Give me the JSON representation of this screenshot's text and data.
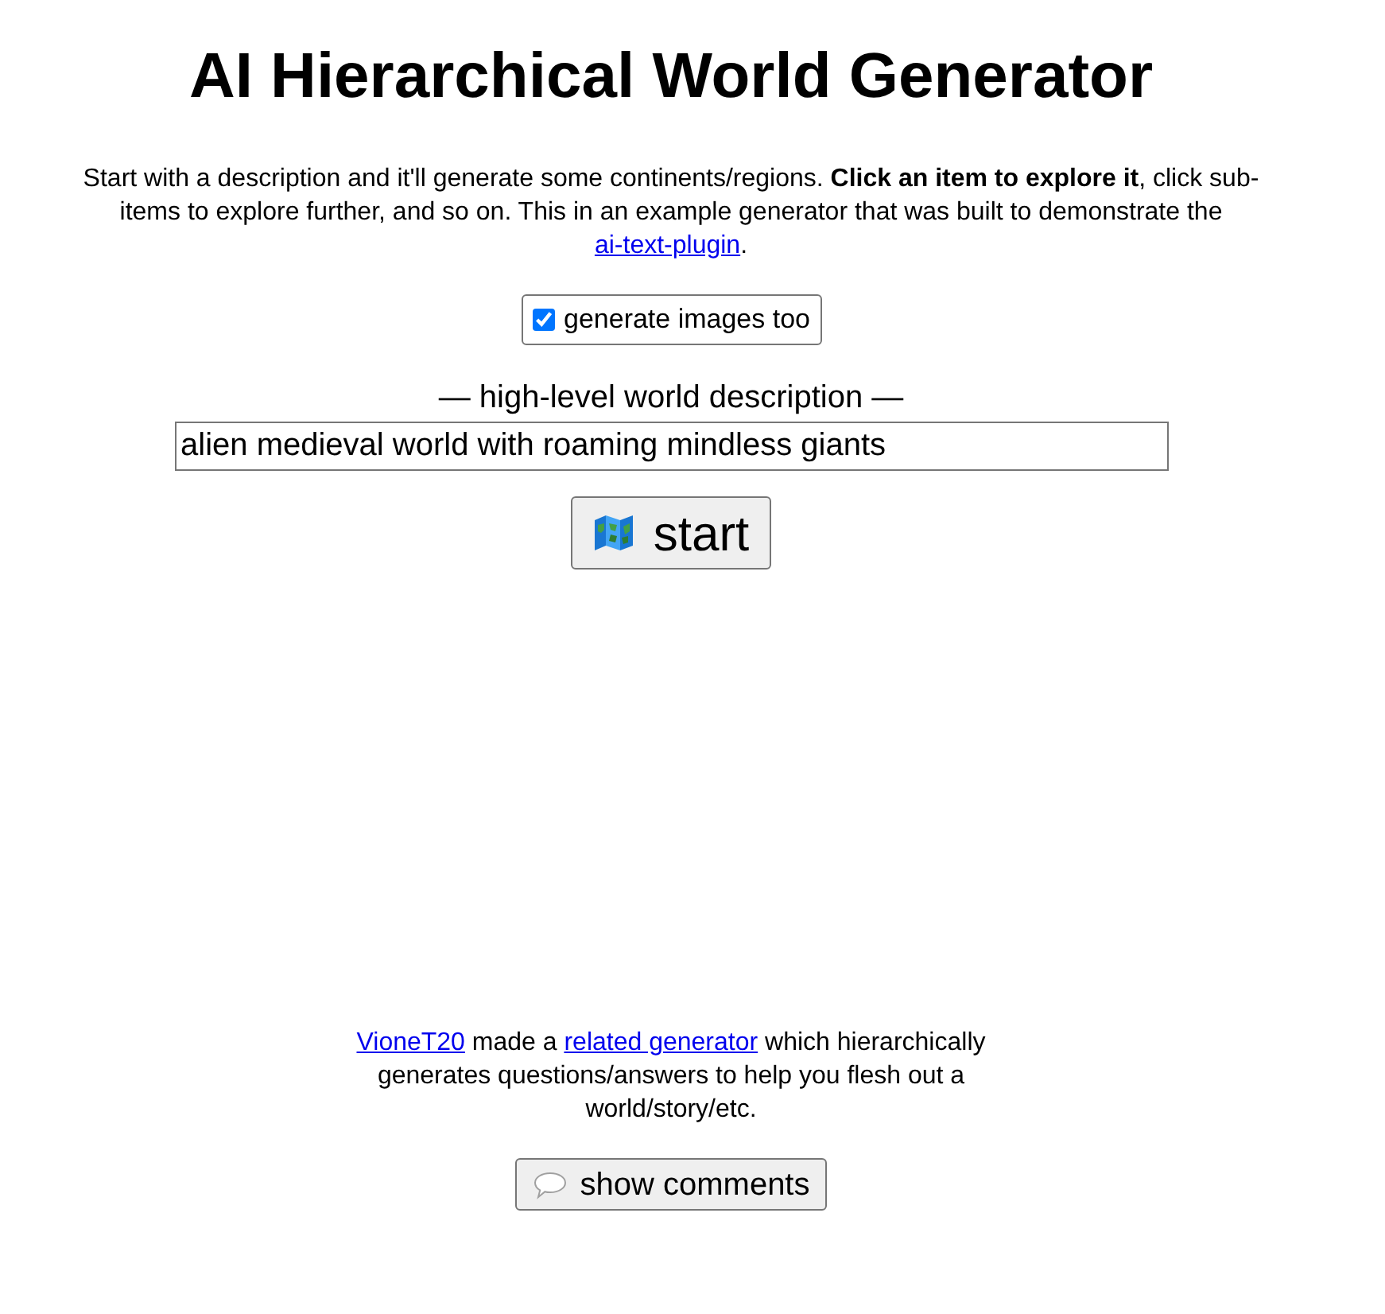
{
  "title": "AI Hierarchical World Generator",
  "intro": {
    "text": "Start with a description and it'll generate some continents/regions. **Click an item to explore it**, click sub-items to explore further, and so on. This in an example generator that was built to demonstrate the ",
    "link": "ai-text-plugin",
    "after": "."
  },
  "images_option": {
    "label": "generate images too",
    "checked": true
  },
  "description": {
    "label": "— high-level world description —",
    "value": "alien medieval world with roaming mindless giants"
  },
  "start_button": {
    "label": "start"
  },
  "footer": {
    "parts": [
      {
        "kind": "link",
        "text": "VioneT20"
      },
      {
        "kind": "text",
        "text": " made a "
      },
      {
        "kind": "link",
        "text": "related generator"
      },
      {
        "kind": "text",
        "text": " which hierarchically generates questions/answers to help you flesh out a world/story/etc."
      }
    ]
  },
  "comments_button": {
    "label": "show comments"
  }
}
